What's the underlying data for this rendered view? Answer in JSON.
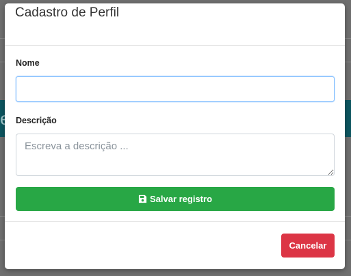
{
  "background": {
    "bar_glyph": "e"
  },
  "modal": {
    "title": "Cadastro de Perfil",
    "fields": {
      "name": {
        "label": "Nome",
        "value": "",
        "placeholder": ""
      },
      "description": {
        "label": "Descrição",
        "value": "",
        "placeholder": "Escreva a descrição ..."
      }
    },
    "save_button": {
      "label": "Salvar registro",
      "icon": "save-icon"
    },
    "cancel_button": {
      "label": "Cancelar"
    }
  },
  "colors": {
    "save": "#28a745",
    "cancel": "#dc3545",
    "focus_border": "#80bdff",
    "overlay": "#6f6f6f",
    "background_bar": "#0d5660"
  }
}
